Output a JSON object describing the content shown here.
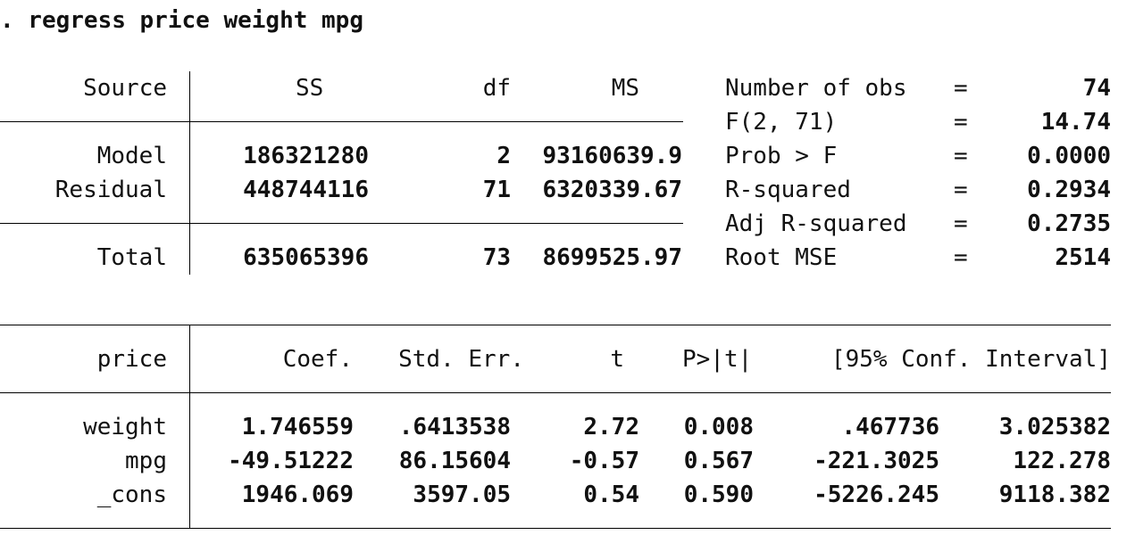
{
  "command": ". regress price weight mpg",
  "anova": {
    "headers": {
      "source": "Source",
      "ss": "SS",
      "df": "df",
      "ms": "MS"
    },
    "rows": [
      {
        "source": "Model",
        "ss": "186321280",
        "df": "2",
        "ms": "93160639.9"
      },
      {
        "source": "Residual",
        "ss": "448744116",
        "df": "71",
        "ms": "6320339.67"
      },
      {
        "source": "Total",
        "ss": "635065396",
        "df": "73",
        "ms": "8699525.97"
      }
    ]
  },
  "fit_stats": [
    {
      "label": "Number of obs",
      "eq": "=",
      "value": "74"
    },
    {
      "label": "F(2, 71)",
      "eq": "=",
      "value": "14.74"
    },
    {
      "label": "Prob > F",
      "eq": "=",
      "value": "0.0000"
    },
    {
      "label": "R-squared",
      "eq": "=",
      "value": "0.2934"
    },
    {
      "label": "Adj R-squared",
      "eq": "=",
      "value": "0.2735"
    },
    {
      "label": "Root MSE",
      "eq": "=",
      "value": "2514"
    }
  ],
  "coef": {
    "headers": {
      "var": "price",
      "coef": "Coef.",
      "se": "Std. Err.",
      "t": "t",
      "p": "P>|t|",
      "ci": "[95% Conf. Interval]"
    },
    "rows": [
      {
        "var": "weight",
        "coef": "1.746559",
        "se": ".6413538",
        "t": "2.72",
        "p": "0.008",
        "lo": ".467736",
        "hi": "3.025382"
      },
      {
        "var": "mpg",
        "coef": "-49.51222",
        "se": "86.15604",
        "t": "-0.57",
        "p": "0.567",
        "lo": "-221.3025",
        "hi": "122.278"
      },
      {
        "var": "_cons",
        "coef": "1946.069",
        "se": "3597.05",
        "t": "0.54",
        "p": "0.590",
        "lo": "-5226.245",
        "hi": "9118.382"
      }
    ]
  }
}
